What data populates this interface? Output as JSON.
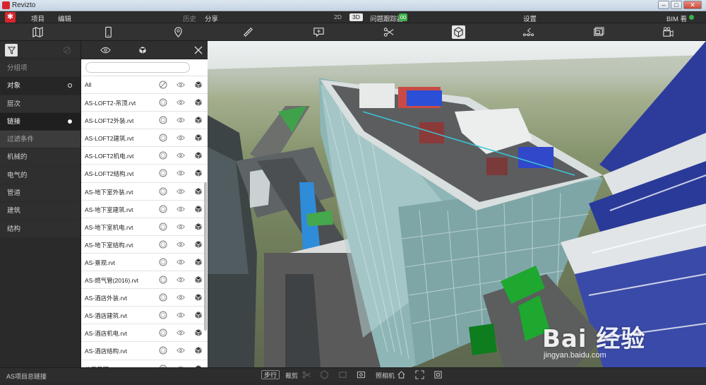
{
  "window": {
    "title": "Revizto"
  },
  "menubar": {
    "items": [
      "项目",
      "编辑"
    ],
    "center_items": [
      "历史",
      "分享"
    ],
    "view_2d": "2D",
    "view_3d": "3D",
    "issue_tracker": "问题跟踪器",
    "issue_badge": "00",
    "settings": "设置",
    "bim": "BIM 看"
  },
  "toolbar": {
    "icons": [
      "map-icon",
      "tablet-icon",
      "location-pin-icon",
      "measure-ruler-icon",
      "add-markup-icon",
      "section-cut-icon",
      "objects-cube-icon",
      "path-nodes-icon",
      "viewpoints-icon",
      "camera-icon"
    ],
    "active": "objects-cube-icon"
  },
  "categories": {
    "items": [
      {
        "label": "分组项",
        "state": "dim"
      },
      {
        "label": "对象",
        "state": "hl",
        "dot": "hollow"
      },
      {
        "label": "层次",
        "state": "normal"
      },
      {
        "label": "链接",
        "state": "sel",
        "dot": "filled"
      },
      {
        "label": "过滤条件",
        "state": "filt"
      },
      {
        "label": "机械的",
        "state": "normal"
      },
      {
        "label": "电气的",
        "state": "normal"
      },
      {
        "label": "管道",
        "state": "normal"
      },
      {
        "label": "建筑",
        "state": "normal"
      },
      {
        "label": "结构",
        "state": "normal"
      }
    ]
  },
  "filelist": {
    "search_placeholder": "",
    "all_label": "All",
    "files": [
      "AS-LOFT2-吊顶.rvt",
      "AS-LOFT2外装.rvt",
      "AS-LOFT2建筑.rvt",
      "AS-LOFT2机电.rvt",
      "AS-LOFT2结构.rvt",
      "AS-地下室外装.rvt",
      "AS-地下室建筑.rvt",
      "AS-地下室机电.rvt",
      "AS-地下室结构.rvt",
      "AS-景观.rvt",
      "AS-燃气管(2016).rvt",
      "AS-酒店外装.rvt",
      "AS-酒店建筑.rvt",
      "AS-酒店机电.rvt",
      "AS-酒店结构.rvt",
      "公寓吊顶.rvt"
    ]
  },
  "statusbar": {
    "left": "AS项目总链接",
    "walk_btn": "步行",
    "clip": "裁剪",
    "camera": "照相机"
  },
  "watermark": {
    "brand": "Bai 经验",
    "url": "jingyan.baidu.com"
  }
}
